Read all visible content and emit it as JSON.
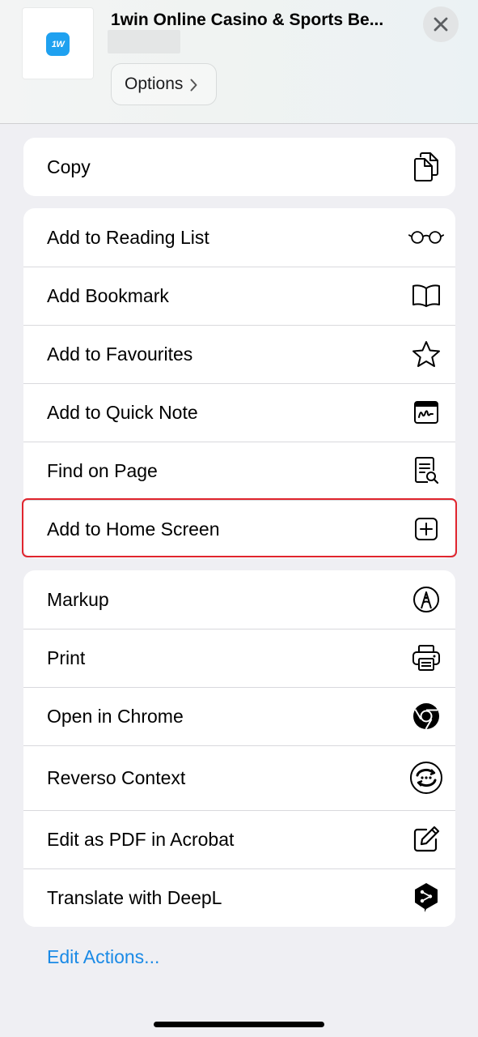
{
  "header": {
    "app_logo_text": "1W",
    "title": "1win Online Casino & Sports Be...",
    "options_label": "Options",
    "logo_color": "#1fa1f0"
  },
  "groups": [
    {
      "rows": [
        {
          "label": "Copy",
          "icon": "copy-icon"
        }
      ]
    },
    {
      "rows": [
        {
          "label": "Add to Reading List",
          "icon": "glasses-icon"
        },
        {
          "label": "Add Bookmark",
          "icon": "book-icon"
        },
        {
          "label": "Add to Favourites",
          "icon": "star-icon"
        },
        {
          "label": "Add to Quick Note",
          "icon": "quick-note-icon"
        },
        {
          "label": "Find on Page",
          "icon": "find-on-page-icon"
        },
        {
          "label": "Add to Home Screen",
          "icon": "plus-square-icon"
        }
      ]
    },
    {
      "rows": [
        {
          "label": "Markup",
          "icon": "markup-pen-icon"
        },
        {
          "label": "Print",
          "icon": "printer-icon"
        },
        {
          "label": "Open in Chrome",
          "icon": "chrome-icon"
        },
        {
          "label": "Reverso Context",
          "icon": "reverso-icon"
        },
        {
          "label": "Edit as PDF in Acrobat",
          "icon": "edit-pencil-icon"
        },
        {
          "label": "Translate with DeepL",
          "icon": "deepl-icon"
        }
      ]
    }
  ],
  "edit_actions_label": "Edit Actions...",
  "highlight_color": "#e0252e",
  "link_color": "#1a8ae6"
}
